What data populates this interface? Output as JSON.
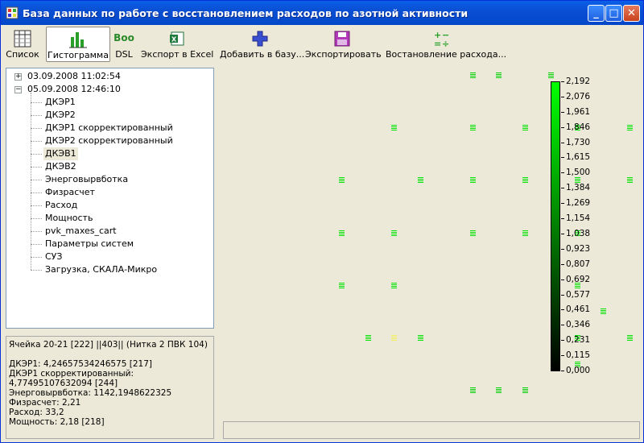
{
  "window": {
    "title": "База данных по работе с восстановлением расходов по азотной активности",
    "minimize": "_",
    "maximize": "□",
    "close": "✕"
  },
  "toolbar": {
    "items": [
      {
        "label": "Список",
        "icon": "list-icon"
      },
      {
        "label": "Гистограмма",
        "icon": "histogram-icon",
        "active": true
      },
      {
        "label": "DSL",
        "icon": "boo-icon",
        "icon_text": "Boo"
      },
      {
        "label": "Экспорт в Excel",
        "icon": "excel-icon"
      },
      {
        "label": "Добавить в базу...",
        "icon": "add-icon"
      },
      {
        "label": "Экспортировать",
        "icon": "save-icon"
      },
      {
        "label": "Востановление расхода...",
        "icon": "calc-icon"
      }
    ]
  },
  "tree": {
    "nodes": [
      {
        "label": "03.09.2008 11:02:54",
        "expander": "+"
      },
      {
        "label": "05.09.2008 12:46:10",
        "expander": "−"
      }
    ],
    "children": [
      "ДКЭР1",
      "ДКЭР2",
      "ДКЭР1 скорректированный",
      "ДКЭР2 скорректированный",
      "ДКЭВ1",
      "ДКЭВ2",
      "Энерговырвботка",
      "Физрасчет",
      "Расход",
      "Мощность",
      "pvk_maxes_cart",
      "Параметры систем",
      "СУЗ",
      "Загрузка, СКАЛА-Микро"
    ],
    "selected_index": 4
  },
  "info": {
    "lines": [
      "Ячейка 20-21 [222] ||403|| (Нитка 2 ПВК 104)",
      "",
      "ДКЭР1: 4,24657534246575 [217]",
      "ДКЭР1 скорректированный: 4,77495107632094 [244]",
      "Энерговырвботка: 1142,1948622325",
      "Физрасчет: 2,21",
      "Расход: 33,2",
      "Мощность: 2,18 [218]"
    ]
  },
  "legend": {
    "labels": [
      "2,192",
      "2,076",
      "1,961",
      "1,846",
      "1,730",
      "1,615",
      "1,500",
      "1,384",
      "1,269",
      "1,154",
      "1,038",
      "0,923",
      "0,807",
      "0,692",
      "0,577",
      "0,461",
      "0,346",
      "0,231",
      "0,115",
      "0,000"
    ],
    "color_top": "#00ff00",
    "color_bottom": "#000000"
  },
  "chart_data": {
    "type": "heatmap",
    "color_scale": {
      "min": 0.0,
      "max": 2.192
    },
    "cells": [
      {
        "col": 9,
        "row": 0,
        "v": 1.85
      },
      {
        "col": 10,
        "row": 0,
        "v": 1.85
      },
      {
        "col": 12,
        "row": 0,
        "v": 1.85
      },
      {
        "col": 6,
        "row": 2,
        "v": 2.05
      },
      {
        "col": 9,
        "row": 2,
        "v": 2.05
      },
      {
        "col": 11,
        "row": 2,
        "v": 2.05
      },
      {
        "col": 13,
        "row": 2,
        "v": 2.05
      },
      {
        "col": 15,
        "row": 2,
        "v": 2.05
      },
      {
        "col": 4,
        "row": 4,
        "v": 2.05
      },
      {
        "col": 7,
        "row": 4,
        "v": 2.05
      },
      {
        "col": 9,
        "row": 4,
        "v": 2.05
      },
      {
        "col": 11,
        "row": 4,
        "v": 2.05
      },
      {
        "col": 13,
        "row": 4,
        "v": 2.05
      },
      {
        "col": 15,
        "row": 4,
        "v": 2.05
      },
      {
        "col": 16,
        "row": 5,
        "v": 2.05
      },
      {
        "col": 4,
        "row": 6,
        "v": 2.05
      },
      {
        "col": 6,
        "row": 6,
        "v": 2.05
      },
      {
        "col": 9,
        "row": 6,
        "v": 2.05
      },
      {
        "col": 11,
        "row": 6,
        "v": 2.05
      },
      {
        "col": 13,
        "row": 6,
        "v": 2.05
      },
      {
        "col": 16,
        "row": 7,
        "v": 2.05
      },
      {
        "col": 4,
        "row": 8,
        "v": 2.05
      },
      {
        "col": 6,
        "row": 8,
        "v": 2.05
      },
      {
        "col": 13,
        "row": 8,
        "v": 2.05
      },
      {
        "col": 14,
        "row": 9,
        "v": 2.05
      },
      {
        "col": 5,
        "row": 10,
        "v": 2.05
      },
      {
        "col": 6,
        "row": 10,
        "v": 2.19
      },
      {
        "col": 7,
        "row": 10,
        "v": 2.05
      },
      {
        "col": 13,
        "row": 10,
        "v": 2.05
      },
      {
        "col": 15,
        "row": 10,
        "v": 2.05
      },
      {
        "col": 13,
        "row": 11,
        "v": 2.05
      },
      {
        "col": 9,
        "row": 12,
        "v": 1.85
      },
      {
        "col": 10,
        "row": 12,
        "v": 1.85
      },
      {
        "col": 11,
        "row": 12,
        "v": 1.85
      }
    ]
  }
}
